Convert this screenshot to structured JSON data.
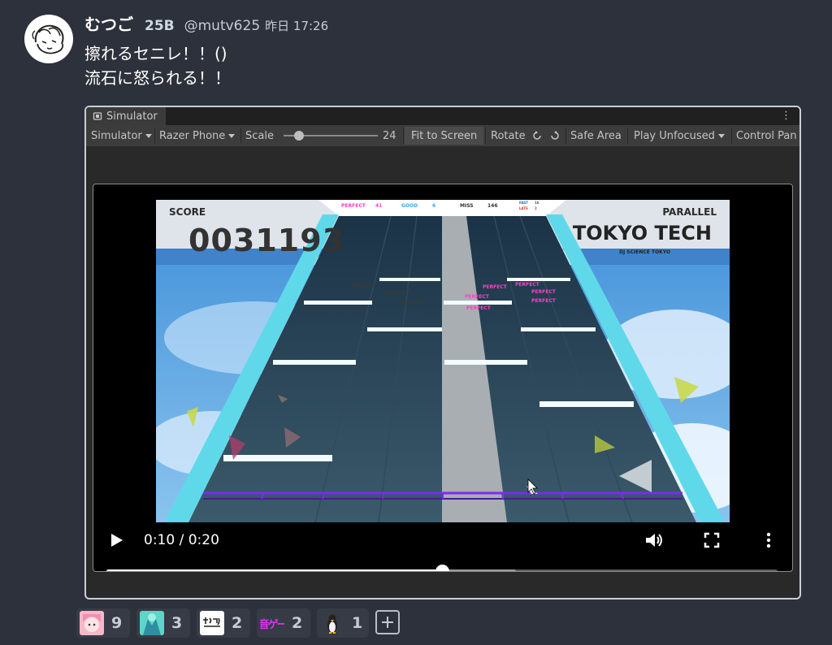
{
  "post": {
    "author_name": "むつご",
    "author_badge": "25B",
    "handle": "@mutv625",
    "timestamp": "昨日 17:26",
    "lines": [
      "擦れるセニレ！！()",
      "流石に怒られる！！"
    ]
  },
  "simulator": {
    "tab_title": "Simulator",
    "toolbar": {
      "mode": "Simulator",
      "device": "Razer Phone",
      "scale_label": "Scale",
      "scale_value": "24",
      "fit_to_screen": "Fit to Screen",
      "rotate": "Rotate",
      "safe_area": "Safe Area",
      "play_unfocused": "Play Unfocused",
      "control_panel": "Control Pan"
    }
  },
  "game": {
    "score_label": "SCORE",
    "score_value": "0031193",
    "perfect_label": "PERFECT",
    "perfect_value": "41",
    "good_label": "GOOD",
    "good_value": "6",
    "miss_label": "MISS",
    "miss_value": "146",
    "fast_label": "FAST",
    "fast_value": "16",
    "late_label": "LATE",
    "late_value": "2",
    "song_title": "PARALLEL",
    "artist": "TOKYO TECH",
    "artist_sub": "DJ SCIENCE TOKYO",
    "judgement_text": "PERFECT"
  },
  "video": {
    "time": "0:10 / 0:20",
    "progress": 0.5,
    "buffered": 0.61
  },
  "reactions": [
    {
      "emoji": "pink-character-emoji",
      "count": "9"
    },
    {
      "emoji": "teal-character-emoji",
      "count": "3"
    },
    {
      "emoji": "sugoi-text-emoji",
      "count": "2"
    },
    {
      "emoji": "music-game-emoji",
      "emoji_text": "音ゲー",
      "count": "2"
    },
    {
      "emoji": "penguin-emoji",
      "count": "1"
    }
  ],
  "colors": {
    "background": "#2d313b",
    "reaction_bg": "#373b46",
    "perfect_pink": "#ff3fc6",
    "lane_cyan": "#58e0ef",
    "judgement_line": "#7a2cf0"
  }
}
